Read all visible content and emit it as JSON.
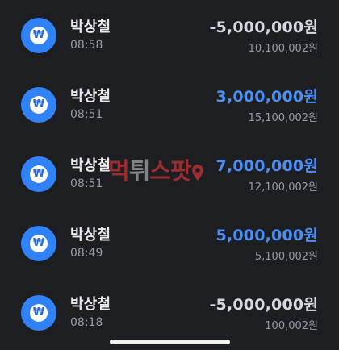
{
  "transactions": [
    {
      "name": "박상철",
      "time": "08:58",
      "amount": "-5,000,000원",
      "balance": "10,100,002원",
      "direction": "out"
    },
    {
      "name": "박상철",
      "time": "08:51",
      "amount": "3,000,000원",
      "balance": "15,100,002원",
      "direction": "in"
    },
    {
      "name": "박상철",
      "time": "08:51",
      "amount": "7,000,000원",
      "balance": "12,100,002원",
      "direction": "in"
    },
    {
      "name": "박상철",
      "time": "08:49",
      "amount": "5,000,000원",
      "balance": "5,100,002원",
      "direction": "in"
    },
    {
      "name": "박상철",
      "time": "08:18",
      "amount": "-5,000,000원",
      "balance": "100,002원",
      "direction": "out"
    }
  ],
  "avatar_icon": {
    "symbol": "₩",
    "name": "won-icon"
  },
  "watermark": {
    "part1": "먹",
    "part2": "튀",
    "part3": "스팟"
  },
  "colors": {
    "background": "#1d1e22",
    "positive_amount": "#4a8ff7",
    "negative_amount": "#d7d7de",
    "avatar": "#3182f6",
    "watermark_red": "#ff3b3b"
  }
}
